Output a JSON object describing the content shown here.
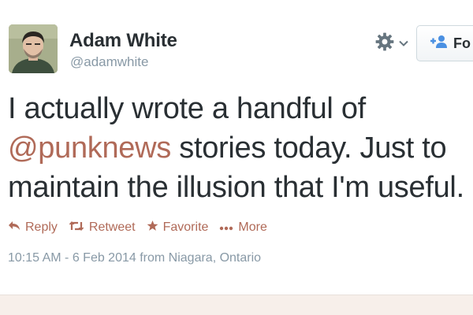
{
  "user": {
    "name": "Adam White",
    "handle": "@adamwhite"
  },
  "header": {
    "settings_icon": "gear-icon",
    "follow_label": "Fo"
  },
  "tweet": {
    "line1": "I actually wrote a handful of",
    "mention": "@punknews",
    "line2_rest": " stories today. Just to",
    "line3": "maintain the illusion that I'm useful."
  },
  "actions": {
    "reply": "Reply",
    "retweet": "Retweet",
    "favorite": "Favorite",
    "more": "More"
  },
  "timestamp": "10:15 AM - 6 Feb 2014 from Niagara, Ontario",
  "colors": {
    "accent": "#b06a58",
    "text": "#292f33",
    "muted": "#8899a6",
    "follow_icon": "#4a90e2"
  }
}
